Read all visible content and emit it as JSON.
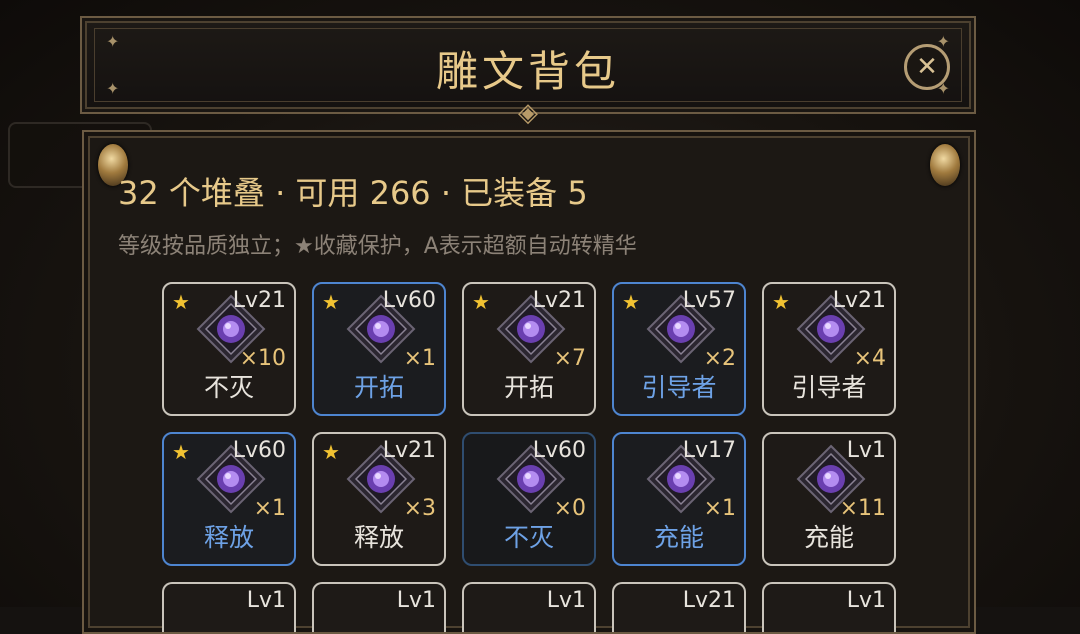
{
  "header": {
    "title": "雕文背包",
    "close_icon": "close-icon"
  },
  "summary": {
    "text": "32 个堆叠 · 可用 266 · 已装备 5",
    "hint": "等级按品质独立；★收藏保护，A表示超额自动转精华"
  },
  "colors": {
    "gold": "#e7c98a",
    "blue_border": "#4e85d0",
    "white_border": "#c9c4bb",
    "star": "#f1c232"
  },
  "glyphs": [
    {
      "star": "★",
      "level": "Lv21",
      "qty": "×10",
      "name": "不灭",
      "style": "white"
    },
    {
      "star": "★",
      "level": "Lv60",
      "qty": "×1",
      "name": "开拓",
      "style": "blue"
    },
    {
      "star": "★",
      "level": "Lv21",
      "qty": "×7",
      "name": "开拓",
      "style": "white"
    },
    {
      "star": "★",
      "level": "Lv57",
      "qty": "×2",
      "name": "引导者",
      "style": "blue"
    },
    {
      "star": "★",
      "level": "Lv21",
      "qty": "×4",
      "name": "引导者",
      "style": "white"
    },
    {
      "star": "★",
      "level": "Lv60",
      "qty": "×1",
      "name": "释放",
      "style": "blue"
    },
    {
      "star": "★",
      "level": "Lv21",
      "qty": "×3",
      "name": "释放",
      "style": "white"
    },
    {
      "star": "",
      "level": "Lv60",
      "qty": "×0",
      "name": "不灭",
      "style": "dim"
    },
    {
      "star": "",
      "level": "Lv17",
      "qty": "×1",
      "name": "充能",
      "style": "blue"
    },
    {
      "star": "",
      "level": "Lv1",
      "qty": "×11",
      "name": "充能",
      "style": "white"
    }
  ],
  "partial_row": [
    {
      "level": "Lv1",
      "style": "white"
    },
    {
      "level": "Lv1",
      "style": "white"
    },
    {
      "level": "Lv1",
      "style": "white"
    },
    {
      "level": "Lv21",
      "style": "white"
    },
    {
      "level": "Lv1",
      "style": "white"
    }
  ]
}
